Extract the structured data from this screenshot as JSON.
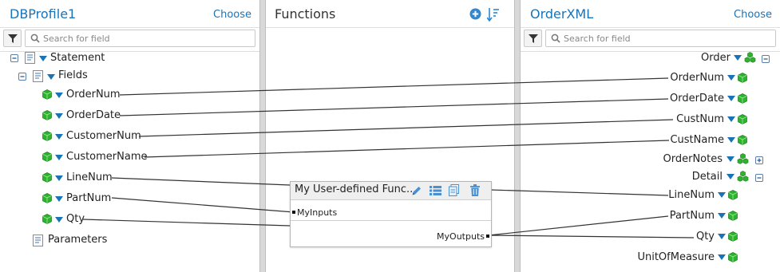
{
  "source": {
    "title": "DBProfile1",
    "choose_label": "Choose",
    "search_placeholder": "Search for field",
    "tree": [
      {
        "label": "Statement",
        "type": "node"
      },
      {
        "label": "Fields",
        "type": "node"
      },
      {
        "label": "OrderNum",
        "type": "field"
      },
      {
        "label": "OrderDate",
        "type": "field"
      },
      {
        "label": "CustomerNum",
        "type": "field"
      },
      {
        "label": "CustomerName",
        "type": "field"
      },
      {
        "label": "LineNum",
        "type": "field"
      },
      {
        "label": "PartNum",
        "type": "field"
      },
      {
        "label": "Qty",
        "type": "field"
      },
      {
        "label": "Parameters",
        "type": "node"
      }
    ]
  },
  "functions": {
    "title": "Functions",
    "add_icon": "plus-circle-icon",
    "sort_icon": "sort-icon",
    "function_box": {
      "title": "My User-defined Func...",
      "input_label": "MyInputs",
      "output_label": "MyOutputs",
      "icons": [
        "edit-icon",
        "list-icon",
        "copy-icon",
        "delete-icon"
      ]
    }
  },
  "target": {
    "title": "OrderXML",
    "choose_label": "Choose",
    "search_placeholder": "Search for field",
    "tree": [
      {
        "label": "Order",
        "type": "group"
      },
      {
        "label": "OrderNum",
        "type": "field"
      },
      {
        "label": "OrderDate",
        "type": "field"
      },
      {
        "label": "CustNum",
        "type": "field"
      },
      {
        "label": "CustName",
        "type": "field"
      },
      {
        "label": "OrderNotes",
        "type": "group"
      },
      {
        "label": "Detail",
        "type": "group"
      },
      {
        "label": "LineNum",
        "type": "field"
      },
      {
        "label": "PartNum",
        "type": "field"
      },
      {
        "label": "Qty",
        "type": "field"
      },
      {
        "label": "UnitOfMeasure",
        "type": "field"
      }
    ]
  },
  "colors": {
    "accent": "#1a73b5",
    "field_green": "#2db32d",
    "arrow_blue": "#1a73b5",
    "wire": "#333333"
  }
}
